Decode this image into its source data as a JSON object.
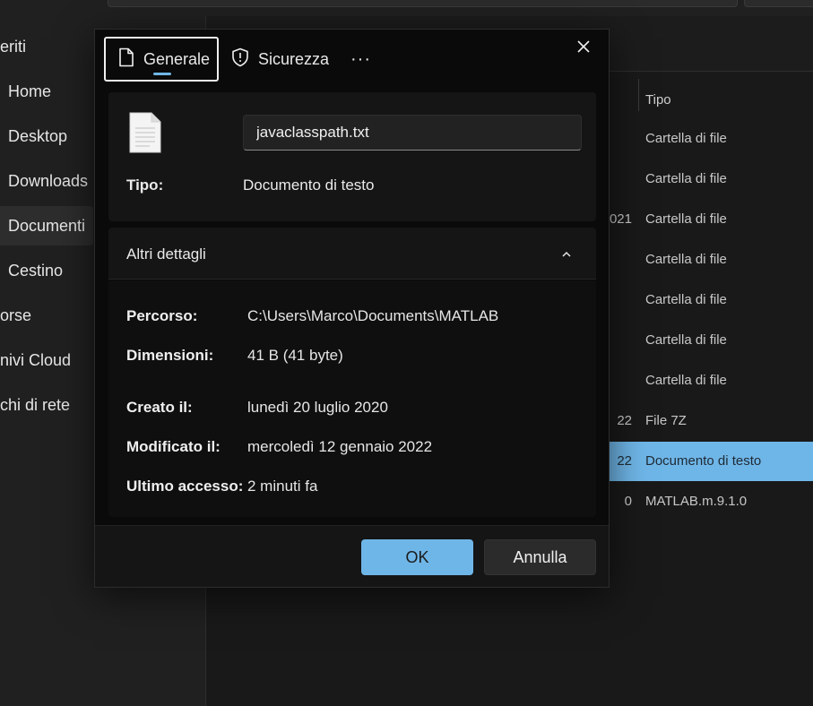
{
  "sidebar": {
    "items": [
      {
        "label": "eriti"
      },
      {
        "label": "Home"
      },
      {
        "label": "Desktop"
      },
      {
        "label": "Downloads"
      },
      {
        "label": "Documenti"
      },
      {
        "label": "Cestino"
      },
      {
        "label": "orse"
      },
      {
        "label": "nivi Cloud"
      },
      {
        "label": "chi di rete"
      }
    ]
  },
  "filelist": {
    "column_type": "Tipo",
    "rows": [
      {
        "date": "",
        "type": "Cartella di file"
      },
      {
        "date": "",
        "type": "Cartella di file"
      },
      {
        "date": "021",
        "type": "Cartella di file"
      },
      {
        "date": "",
        "type": "Cartella di file"
      },
      {
        "date": "",
        "type": "Cartella di file"
      },
      {
        "date": "",
        "type": "Cartella di file"
      },
      {
        "date": "",
        "type": "Cartella di file"
      },
      {
        "date": "22",
        "type": "File 7Z"
      },
      {
        "date": "22",
        "type": "Documento di testo"
      },
      {
        "date": "0",
        "type": "MATLAB.m.9.1.0"
      }
    ]
  },
  "dialog": {
    "tabs": {
      "general": "Generale",
      "security": "Sicurezza",
      "more": "···"
    },
    "file_name": "javaclasspath.txt",
    "type_label": "Tipo:",
    "type_value": "Documento di testo",
    "details_title": "Altri dettagli",
    "details": {
      "path_label": "Percorso:",
      "path_value": "C:\\Users\\Marco\\Documents\\MATLAB",
      "size_label": "Dimensioni:",
      "size_value": "41 B (41 byte)",
      "created_label": "Creato il:",
      "created_value": "lunedì 20 luglio 2020",
      "modified_label": "Modificato il:",
      "modified_value": "mercoledì 12 gennaio 2022",
      "accessed_label": "Ultimo accesso:",
      "accessed_value": "2 minuti fa"
    },
    "ok_label": "OK",
    "cancel_label": "Annulla"
  },
  "colors": {
    "accent": "#6fb6e8",
    "dialog_bg": "#0a0a0a",
    "window_bg": "#202020"
  }
}
